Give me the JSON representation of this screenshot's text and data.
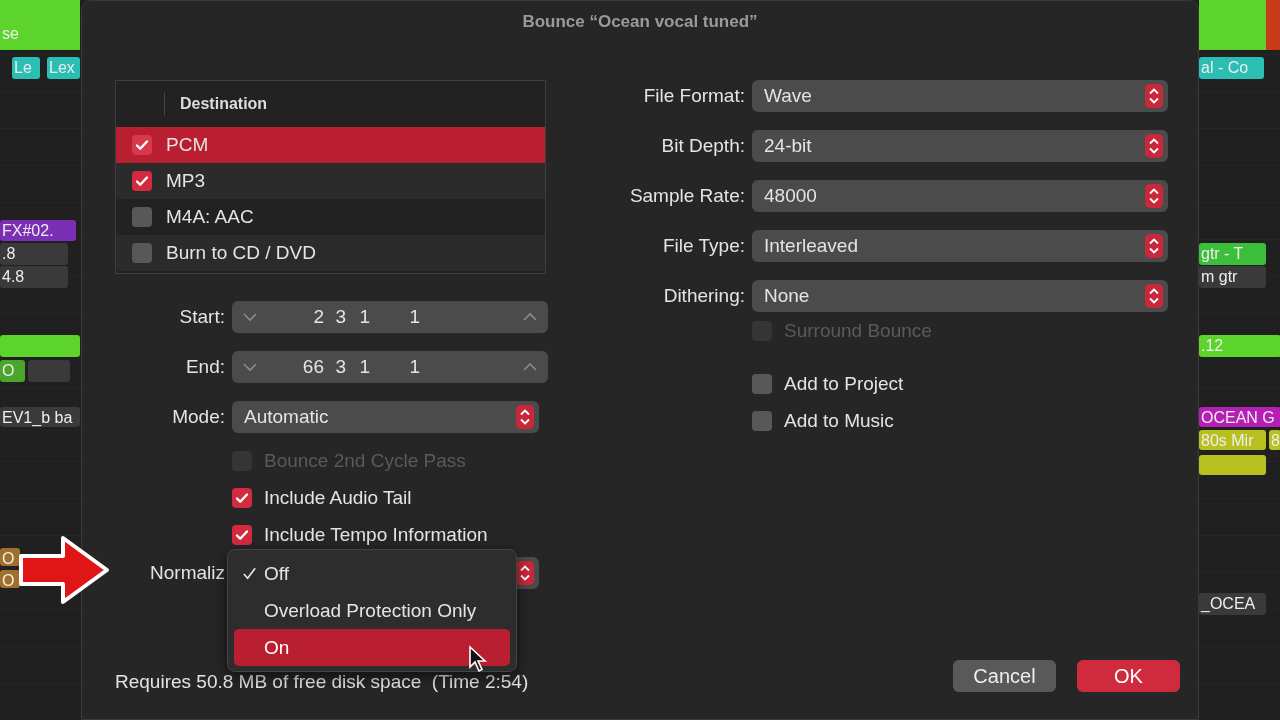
{
  "background": {
    "left_regions": [
      {
        "text": "se",
        "color": "#5cd42c"
      },
      {
        "text": "Le",
        "color": "#2bbfb3"
      },
      {
        "text": "Lex",
        "color": "#2bbfb3"
      },
      {
        "text": "FX#02.",
        "color": "#7a2fb5"
      },
      {
        "text": ".8",
        "color": "#3a3a3a"
      },
      {
        "text": "4.8",
        "color": "#3a3a3a"
      },
      {
        "color": "#5cd42c"
      },
      {
        "text": "O",
        "color": "#4aa62a"
      },
      {
        "color": "#3a3a3a"
      },
      {
        "text": "EV1_b ba",
        "color": "#3a3a3a"
      },
      {
        "text": "O",
        "color": "#a0702a"
      },
      {
        "text": "O",
        "color": "#a0702a"
      }
    ],
    "right_regions": [
      {
        "color": "#5cd42c"
      },
      {
        "color": "#c83a1a"
      },
      {
        "text": "al - Co",
        "color": "#2bbfb3"
      },
      {
        "text": "gtr - T",
        "color": "#3bbf3a"
      },
      {
        "text": "m gtr",
        "color": "#3a3a3a"
      },
      {
        "text": ".12",
        "color": "#5cd42c"
      },
      {
        "text": "OCEAN G",
        "color": "#b51fb5"
      },
      {
        "text": "80s Mir",
        "color": "#b8c020"
      },
      {
        "text": "8",
        "color": "#b8c020"
      },
      {
        "color": "#b8c020"
      },
      {
        "text": "_OCEA",
        "color": "#3a3a3a"
      }
    ]
  },
  "dialog": {
    "title": "Bounce “Ocean vocal tuned”",
    "destination": {
      "header": "Destination",
      "rows": [
        {
          "label": "PCM",
          "checked": true,
          "selected": true
        },
        {
          "label": "MP3",
          "checked": true,
          "selected": false
        },
        {
          "label": "M4A: AAC",
          "checked": false,
          "selected": false
        },
        {
          "label": "Burn to CD / DVD",
          "checked": false,
          "selected": false
        }
      ]
    },
    "start": {
      "label": "Start:",
      "segments": [
        "2",
        "3",
        "1",
        "1"
      ]
    },
    "end": {
      "label": "End:",
      "segments": [
        "66",
        "3",
        "1",
        "1"
      ]
    },
    "mode": {
      "label": "Mode:",
      "value": "Automatic"
    },
    "options": [
      {
        "label": "Bounce 2nd Cycle Pass",
        "checked": false,
        "disabled": true
      },
      {
        "label": "Include Audio Tail",
        "checked": true,
        "disabled": false
      },
      {
        "label": "Include Tempo Information",
        "checked": true,
        "disabled": false
      }
    ],
    "normalize": {
      "label": "Normaliz",
      "menu": [
        {
          "label": "Off",
          "checked": true,
          "selected": false
        },
        {
          "label": "Overload Protection Only",
          "checked": false,
          "selected": false
        },
        {
          "label": "On",
          "checked": false,
          "selected": true
        }
      ]
    },
    "settings": [
      {
        "label": "File Format:",
        "value": "Wave"
      },
      {
        "label": "Bit Depth:",
        "value": "24-bit"
      },
      {
        "label": "Sample Rate:",
        "value": "48000"
      },
      {
        "label": "File Type:",
        "value": "Interleaved"
      },
      {
        "label": "Dithering:",
        "value": "None"
      }
    ],
    "right_options": [
      {
        "label": "Surround Bounce",
        "checked": false,
        "disabled": true
      },
      {
        "label": "Add to Project",
        "checked": false,
        "disabled": false
      },
      {
        "label": "Add to Music",
        "checked": false,
        "disabled": false
      }
    ],
    "footer": "Requires 50.8 MB of free disk space  (Time 2:54)",
    "buttons": [
      {
        "label": "Cancel",
        "kind": "secondary"
      },
      {
        "label": "OK",
        "kind": "primary"
      }
    ]
  }
}
